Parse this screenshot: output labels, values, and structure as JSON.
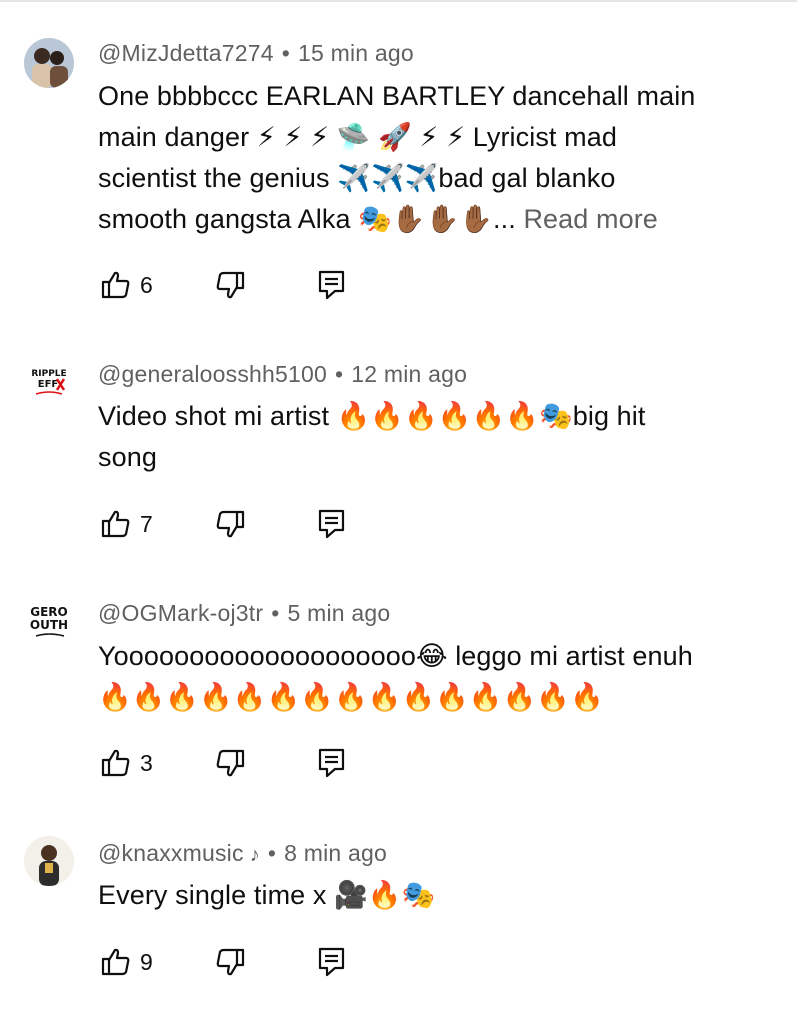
{
  "comments": [
    {
      "author": "@MizJdetta7274",
      "separator": "•",
      "time": "15 min ago",
      "lines": [
        "One bbbbccc EARLAN BARTLEY dancehall main",
        "main danger ⚡ ⚡ ⚡ 🛸 🚀 ⚡ ⚡  Lyricist mad",
        "scientist the genius ✈️✈️✈️bad gal blanko",
        "smooth gangsta Alka 🎭✋🏾✋🏾✋🏾..."
      ],
      "read_more": " Read more",
      "likes": "6"
    },
    {
      "author": "@generaloosshh5100",
      "separator": "•",
      "time": "12 min ago",
      "lines": [
        "Video shot mi artist 🔥🔥🔥🔥🔥🔥🎭big hit",
        "song"
      ],
      "likes": "7"
    },
    {
      "author": "@OGMark-oj3tr",
      "separator": "•",
      "time": "5 min ago",
      "lines": [
        "Yoooooooooooooooooooo😂 leggo mi artist enuh",
        "🔥🔥🔥🔥🔥🔥🔥🔥🔥🔥🔥🔥🔥🔥🔥"
      ],
      "likes": "3"
    },
    {
      "author": "@knaxxmusic",
      "note_icon": "♪",
      "separator": "•",
      "time": "8 min ago",
      "lines": [
        "Every single time x 🎥🔥🎭"
      ],
      "likes": "9"
    }
  ],
  "icons": {
    "like": "thumbs-up-icon",
    "dislike": "thumbs-down-icon",
    "reply": "reply-comment-icon",
    "note": "music-note-icon"
  }
}
